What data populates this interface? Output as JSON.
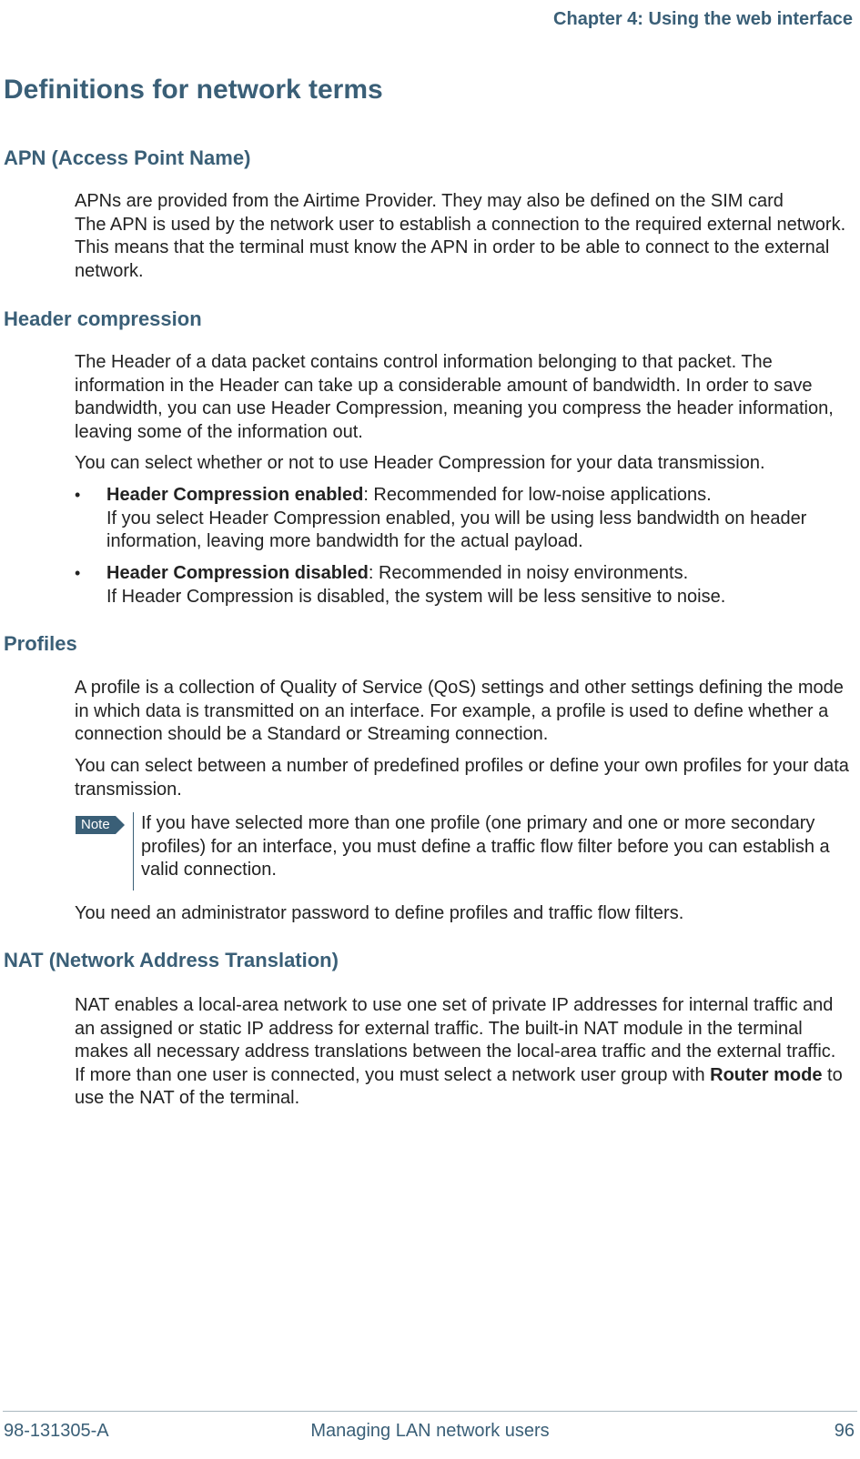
{
  "chapter_header": "Chapter 4: Using the web interface",
  "main_heading": "Definitions for network terms",
  "sections": {
    "apn": {
      "heading": "APN (Access Point Name)",
      "p1_a": "APNs are provided from the Airtime Provider. They may also be defined on the SIM card",
      "p1_b": "The APN is used by the network user to establish a connection to the required external network. This means that the terminal must know the APN in order to be able to connect to the external network."
    },
    "header_compression": {
      "heading": "Header compression",
      "p1": "The Header of a data packet contains control information belonging to that packet. The information in the Header can take up a considerable amount of bandwidth. In order to save bandwidth, you can use Header Compression, meaning you compress the header information, leaving some of the information out.",
      "p2": "You can select whether or not to use Header Compression for your data transmission.",
      "b1_lead": "Header Compression enabled",
      "b1_rest_a": ": Recommended for low-noise applications.",
      "b1_rest_b": "If you select Header Compression enabled, you will be using less bandwidth on header information, leaving more bandwidth for the actual payload.",
      "b2_lead": "Header Compression disabled",
      "b2_rest_a": ": Recommended in noisy environments.",
      "b2_rest_b": "If Header Compression is disabled, the system will be less sensitive to noise."
    },
    "profiles": {
      "heading": "Profiles",
      "p1": "A profile is a collection of Quality of Service (QoS) settings and other settings defining the mode in which data is transmitted on an interface. For example, a profile is used to define whether a connection should be a Standard or Streaming connection.",
      "p2": "You can select between a number of predefined profiles or define your own profiles for your data transmission.",
      "note_label": "Note",
      "note": "If you have selected more than one profile (one primary and one or more secondary profiles) for an interface, you must define a traffic flow filter before you can establish a valid connection.",
      "p3": "You need an administrator password to define profiles and traffic flow filters."
    },
    "nat": {
      "heading": "NAT (Network Address Translation)",
      "p1_a": "NAT enables a local-area network to use one set of private IP addresses for internal traffic and an assigned or static IP address for external traffic. The built-in NAT module in the terminal makes all necessary address translations between the local-area traffic and the external traffic.",
      "p1_b_pre": "If more than one user is connected, you must select a network user group with ",
      "p1_b_bold": "Router mode",
      "p1_b_post": " to use the NAT of the terminal."
    }
  },
  "footer": {
    "left": "98-131305-A",
    "center": "Managing LAN network users",
    "right": "96"
  }
}
